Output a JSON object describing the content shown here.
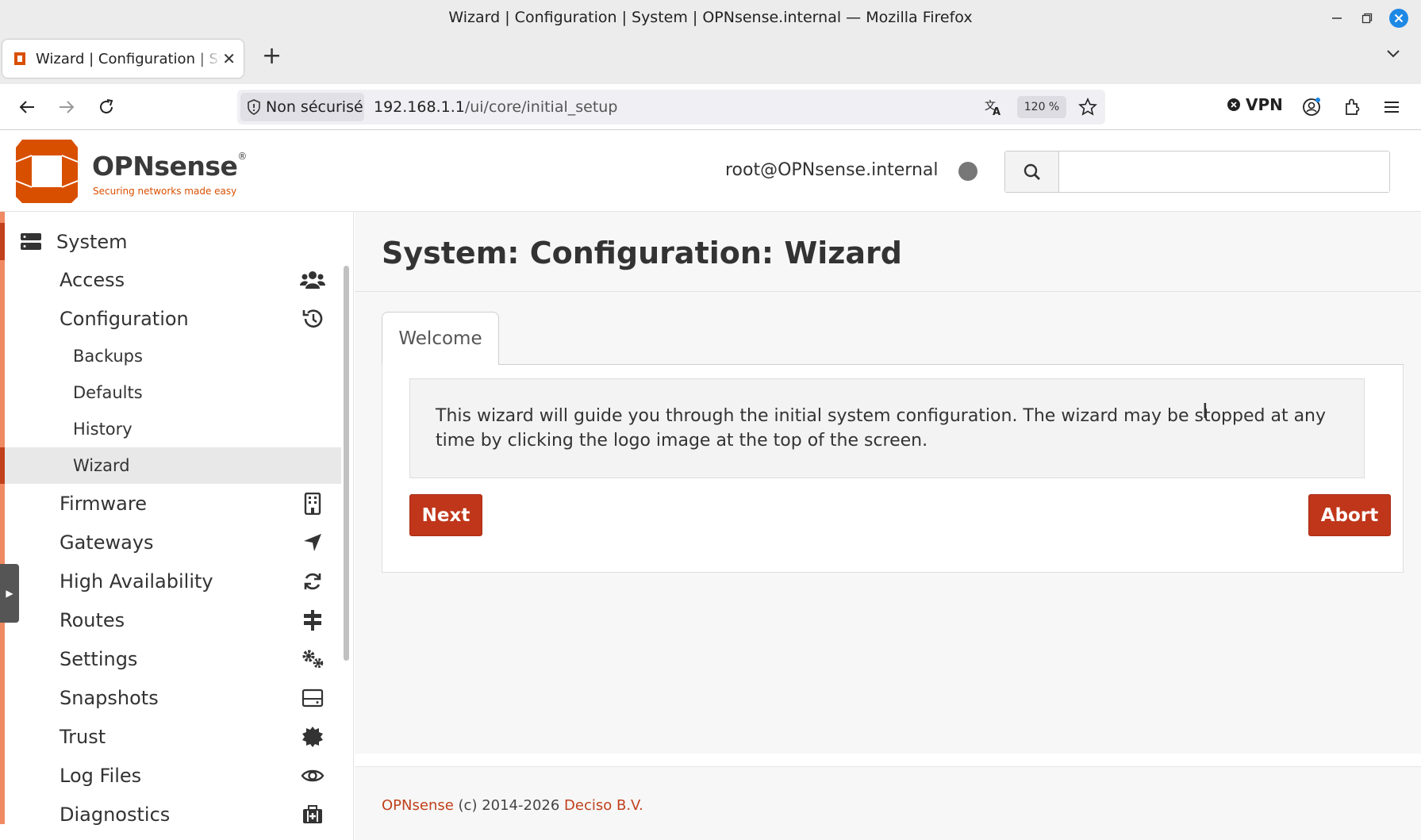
{
  "browser": {
    "window_title": "Wizard | Configuration | System | OPNsense.internal — Mozilla Firefox",
    "tab_title": "Wizard | Configuration | System | OPNsense.internal",
    "site_security_label": "Non sécurisé",
    "url_host": "192.168.1.1",
    "url_path": "/ui/core/initial_setup",
    "zoom": "120 %",
    "vpn_label": "VPN"
  },
  "header": {
    "brand": "OPNsense",
    "brand_mark": "®",
    "tagline": "Securing networks made easy",
    "user": "root@OPNsense.internal",
    "search_placeholder": ""
  },
  "sidebar": {
    "section": "System",
    "items": [
      {
        "label": "Access",
        "icon": "users-icon",
        "level": 1
      },
      {
        "label": "Configuration",
        "icon": "history-icon",
        "level": 1
      },
      {
        "label": "Backups",
        "level": 2
      },
      {
        "label": "Defaults",
        "level": 2
      },
      {
        "label": "History",
        "level": 2
      },
      {
        "label": "Wizard",
        "level": 2,
        "active": true
      },
      {
        "label": "Firmware",
        "icon": "building-icon",
        "level": 1
      },
      {
        "label": "Gateways",
        "icon": "location-arrow-icon",
        "level": 1
      },
      {
        "label": "High Availability",
        "icon": "refresh-icon",
        "level": 1
      },
      {
        "label": "Routes",
        "icon": "signpost-icon",
        "level": 1
      },
      {
        "label": "Settings",
        "icon": "cogs-icon",
        "level": 1
      },
      {
        "label": "Snapshots",
        "icon": "drive-icon",
        "level": 1
      },
      {
        "label": "Trust",
        "icon": "certificate-icon",
        "level": 1
      },
      {
        "label": "Log Files",
        "icon": "eye-icon",
        "level": 1
      },
      {
        "label": "Diagnostics",
        "icon": "medkit-icon",
        "level": 1
      }
    ]
  },
  "main": {
    "title": "System: Configuration: Wizard",
    "tab": "Welcome",
    "message": "This wizard will guide you through the initial system configuration. The wizard may be stopped at any time by clicking the logo image at the top of the screen.",
    "next_label": "Next",
    "abort_label": "Abort"
  },
  "footer": {
    "brand_link": "OPNsense",
    "copyright": " (c) 2014-2026 ",
    "company_link": "Deciso B.V."
  },
  "colors": {
    "accent": "#c0411c",
    "button": "#c0361a",
    "sidebar_stripe": "#f08a63"
  }
}
